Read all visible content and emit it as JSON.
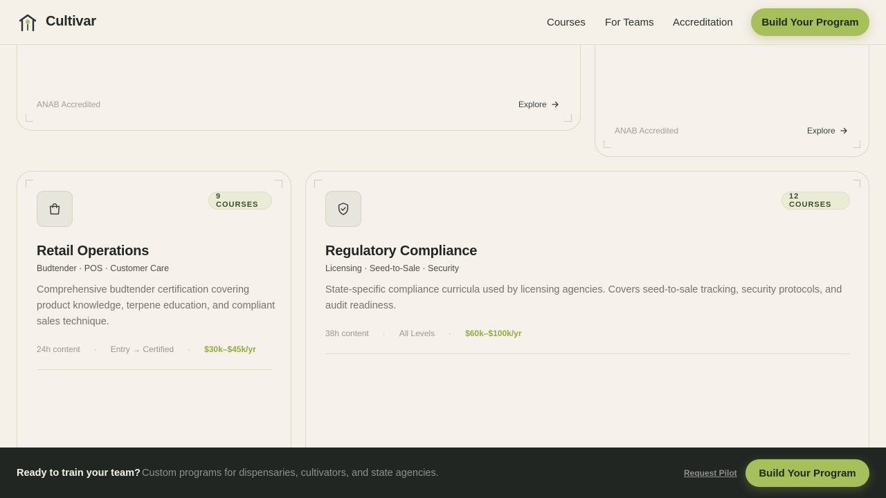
{
  "brand": {
    "name": "Cultivar",
    "logo_icon": "home-leaf-icon"
  },
  "nav": {
    "links": [
      "Courses",
      "For Teams",
      "Accreditation"
    ],
    "cta": "Build Your Program"
  },
  "top_cards": [
    {
      "accreditation": "ANAB Accredited",
      "action": "Explore"
    },
    {
      "accreditation": "ANAB Accredited",
      "action": "Explore"
    }
  ],
  "cards": [
    {
      "icon": "shopping-bag-icon",
      "badge": "9 COURSES",
      "title": "Retail Operations",
      "tags": "Budtender · POS · Customer Care",
      "description": "Comprehensive budtender certification covering product knowledge, terpene education, and compliant sales technique.",
      "content": "24h content",
      "level": "Entry → Certified",
      "salary": "$30k–$45k/yr"
    },
    {
      "icon": "shield-check-icon",
      "badge": "12 COURSES",
      "title": "Regulatory Compliance",
      "tags": "Licensing · Seed-to-Sale · Security",
      "description": "State-specific compliance curricula used by licensing agencies. Covers seed-to-sale tracking, security protocols, and audit readiness.",
      "content": "38h content",
      "level": "All Levels",
      "salary": "$60k–$100k/yr"
    }
  ],
  "meta_separator": "·",
  "bottom_bar": {
    "title": "Ready to train your team?",
    "subtitle": "Custom programs for dispensaries, cultivators, and state agencies.",
    "link": "Request Pilot",
    "cta": "Build Your Program"
  },
  "colors": {
    "background": "#f5f0e8",
    "accent": "#a6c05a",
    "salary": "#8fae3a",
    "bar": "#212623"
  }
}
